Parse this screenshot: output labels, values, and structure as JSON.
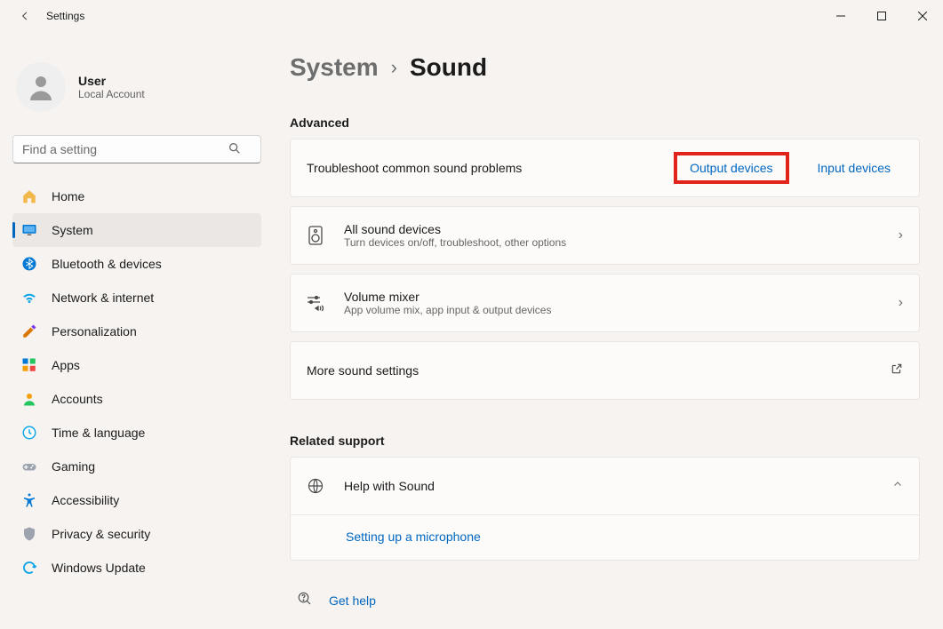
{
  "window": {
    "title": "Settings"
  },
  "user": {
    "name": "User",
    "sub": "Local Account"
  },
  "search": {
    "placeholder": "Find a setting"
  },
  "nav": {
    "home": "Home",
    "system": "System",
    "bluetooth": "Bluetooth & devices",
    "network": "Network & internet",
    "personalization": "Personalization",
    "apps": "Apps",
    "accounts": "Accounts",
    "time": "Time & language",
    "gaming": "Gaming",
    "accessibility": "Accessibility",
    "privacy": "Privacy & security",
    "update": "Windows Update"
  },
  "breadcrumb": {
    "parent": "System",
    "current": "Sound"
  },
  "sections": {
    "advanced": "Advanced",
    "related": "Related support"
  },
  "cards": {
    "troubleshoot": {
      "title": "Troubleshoot common sound problems",
      "output": "Output devices",
      "input": "Input devices"
    },
    "alldevices": {
      "title": "All sound devices",
      "sub": "Turn devices on/off, troubleshoot, other options"
    },
    "mixer": {
      "title": "Volume mixer",
      "sub": "App volume mix, app input & output devices"
    },
    "more": {
      "title": "More sound settings"
    },
    "help": {
      "title": "Help with Sound",
      "link": "Setting up a microphone"
    }
  },
  "gethelp": "Get help"
}
